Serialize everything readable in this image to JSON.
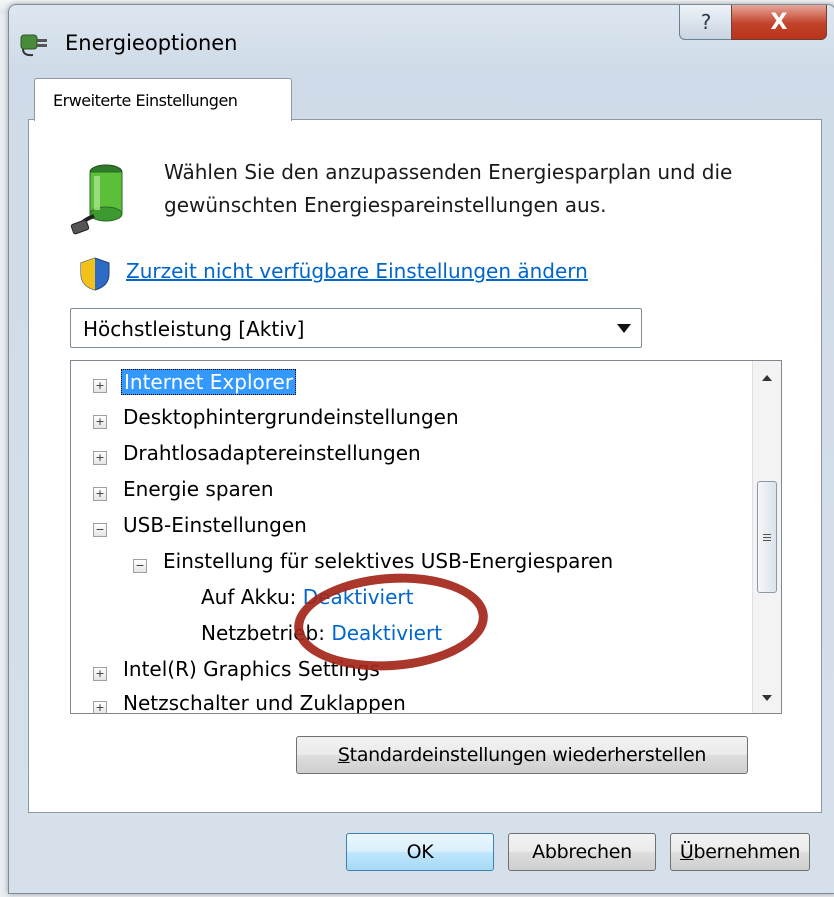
{
  "window": {
    "title": "Energieoptionen",
    "help_label": "?",
    "close_label": "X"
  },
  "tab": {
    "label": "Erweiterte Einstellungen"
  },
  "description": {
    "line1": "Wählen Sie den anzupassenden Energiesparplan und die",
    "line2": "gewünschten Energiespareinstellungen aus."
  },
  "link": {
    "label": "Zurzeit nicht verfügbare Einstellungen ändern"
  },
  "plan_dropdown": {
    "selected": "Höchstleistung [Aktiv]"
  },
  "tree": {
    "items": [
      {
        "toggle": "+",
        "label": "Internet Explorer",
        "selected": true
      },
      {
        "toggle": "+",
        "label": "Desktophintergrundeinstellungen"
      },
      {
        "toggle": "+",
        "label": "Drahtlosadaptereinstellungen"
      },
      {
        "toggle": "+",
        "label": "Energie sparen"
      },
      {
        "toggle": "−",
        "label": "USB-Einstellungen"
      },
      {
        "toggle": "−",
        "label": "Einstellung für selektives USB-Energiesparen"
      },
      {
        "label": "Auf Akku:",
        "value": "Deaktiviert"
      },
      {
        "label": "Netzbetrieb:",
        "value": "Deaktiviert"
      },
      {
        "toggle": "+",
        "label": "Intel(R) Graphics Settings"
      },
      {
        "toggle": "+",
        "label": "Netzschalter und Zuklappen"
      }
    ]
  },
  "buttons": {
    "restore_defaults": {
      "prefix": "",
      "accel": "S",
      "rest": "tandardeinstellungen wiederherstellen"
    },
    "ok": "OK",
    "cancel": "Abbrechen",
    "apply": {
      "accel": "Ü",
      "rest": "bernehmen"
    }
  },
  "colors": {
    "link": "#0066cc",
    "selection": "#3399ff",
    "annotation_circle": "#a3251a"
  }
}
